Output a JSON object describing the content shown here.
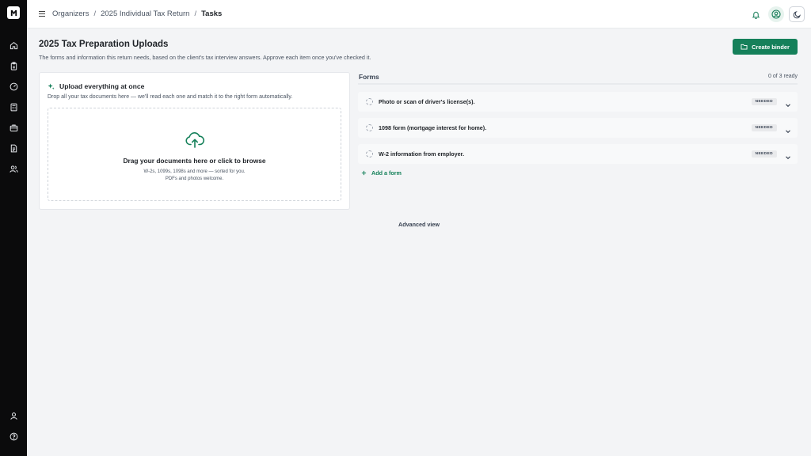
{
  "sidebar": {
    "logo_icon": "brand-logo-icon",
    "items": [
      {
        "name": "home-icon"
      },
      {
        "name": "clipboard-icon"
      },
      {
        "name": "gauge-icon"
      },
      {
        "name": "calculator-icon"
      },
      {
        "name": "briefcase-icon"
      },
      {
        "name": "document-icon"
      },
      {
        "name": "users-icon"
      }
    ],
    "bottom_items": [
      {
        "name": "profile-icon"
      },
      {
        "name": "help-icon"
      }
    ]
  },
  "topbar": {
    "breadcrumb": [
      "Organizers",
      "2025 Individual Tax Return",
      "Tasks"
    ],
    "icons": [
      "bell-icon",
      "account-icon",
      "moon-icon"
    ]
  },
  "page": {
    "title": "2025 Tax Preparation Uploads",
    "subtitle": "The forms and information this return needs, based on the client's tax interview answers. Approve each item once you've checked it.",
    "create_button": "Create binder"
  },
  "upload": {
    "title": "Upload everything at once",
    "description": "Drop all your tax documents here — we'll read each one and match it to the right form automatically.",
    "drop_title": "Drag your documents here or click to browse",
    "drop_hint": "W-2s, 1099s, 1098s and more — sorted for you. PDFs and photos welcome."
  },
  "forms": {
    "label": "Forms",
    "count": "0 of 3 ready",
    "items": [
      {
        "name": "Photo or scan of driver's license(s).",
        "status": "NEEDED"
      },
      {
        "name": "1098 form (mortgage interest for home).",
        "status": "NEEDED"
      },
      {
        "name": "W-2 information from employer.",
        "status": "NEEDED"
      }
    ],
    "add_label": "Add a form"
  },
  "advanced_view": "Advanced view",
  "colors": {
    "accent": "#15805a",
    "sidebar": "#0b0b0c",
    "background": "#f3f4f6"
  }
}
